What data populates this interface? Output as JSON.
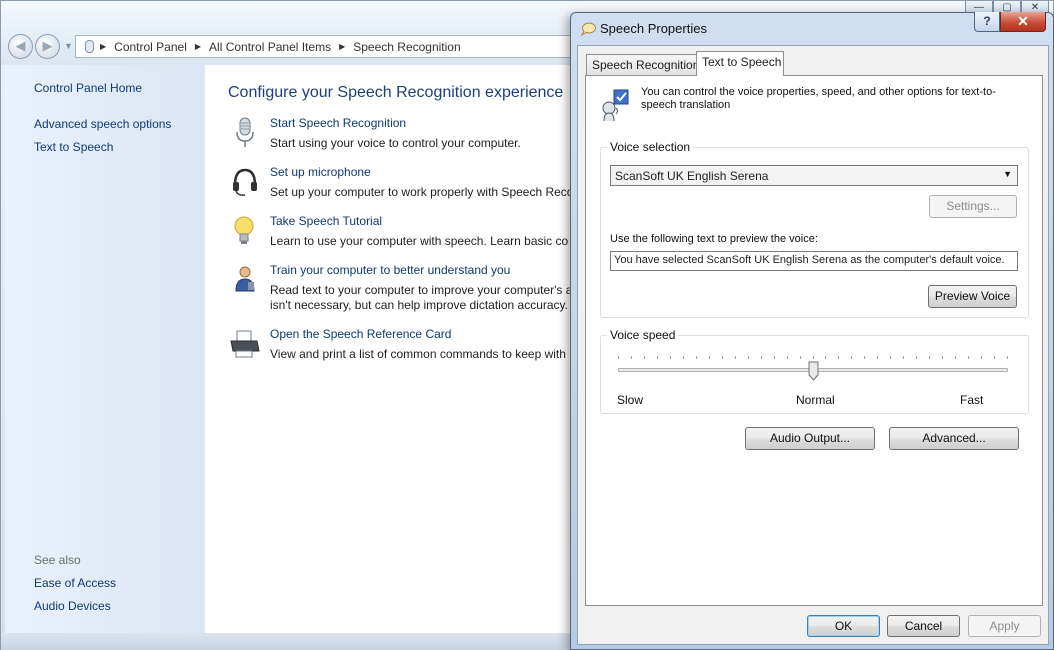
{
  "control_panel": {
    "caption_buttons": [
      "—",
      "▢",
      "✕"
    ],
    "nav": {
      "back": "◀",
      "forward": "▶",
      "recent": "▼"
    },
    "address": [
      "Control Panel",
      "All Control Panel Items",
      "Speech Recognition"
    ],
    "sidebar": {
      "home": "Control Panel Home",
      "links": [
        "Advanced speech options",
        "Text to Speech"
      ],
      "see_also_title": "See also",
      "see_also": [
        "Ease of Access",
        "Audio Devices"
      ]
    },
    "main": {
      "title": "Configure your Speech Recognition experience",
      "tasks": [
        {
          "icon": "microphone-icon",
          "link": "Start Speech Recognition",
          "desc": "Start using your voice to control your computer."
        },
        {
          "icon": "headset-icon",
          "link": "Set up microphone",
          "desc": "Set up your computer to work properly with Speech Reco"
        },
        {
          "icon": "lightbulb-icon",
          "link": "Take Speech Tutorial",
          "desc": "Learn to use your computer with speech.  Learn basic co"
        },
        {
          "icon": "user-train-icon",
          "link": "Train your computer to better understand you",
          "desc": "Read text to your computer to improve your computer's a\nisn't necessary, but can help improve dictation accuracy."
        },
        {
          "icon": "printer-icon",
          "link": "Open the Speech Reference Card",
          "desc": "View and print a list of common commands to keep with"
        }
      ]
    }
  },
  "dialog": {
    "title": "Speech Properties",
    "help_button": "?",
    "close_button": "✕",
    "tabs": [
      {
        "label": "Speech Recognition",
        "active": false
      },
      {
        "label": "Text to Speech",
        "active": true
      }
    ],
    "info_text": "You can control the voice properties, speed, and other options for text-to-speech translation",
    "voice_selection": {
      "title": "Voice selection",
      "selected_voice": "ScanSoft UK English Serena",
      "settings_button": "Settings...",
      "preview_label": "Use the following text to preview the voice:",
      "preview_text": "You have selected ScanSoft UK English Serena as the computer's default voice.",
      "preview_button": "Preview Voice"
    },
    "voice_speed": {
      "title": "Voice speed",
      "labels": {
        "slow": "Slow",
        "normal": "Normal",
        "fast": "Fast"
      },
      "value_fraction": 0.5
    },
    "audio_output_button": "Audio Output...",
    "advanced_button": "Advanced...",
    "footer": {
      "ok": "OK",
      "cancel": "Cancel",
      "apply": "Apply"
    }
  },
  "colors": {
    "link": "#0f3a70",
    "title": "#1e3f7b",
    "close_red": "#c94d37"
  }
}
